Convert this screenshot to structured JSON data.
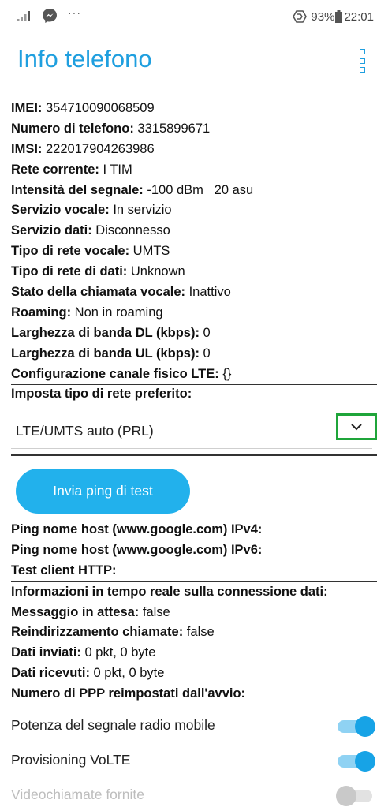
{
  "status_bar": {
    "more": "···",
    "battery": "93%",
    "time": "22:01"
  },
  "header": {
    "title": "Info telefono"
  },
  "info": [
    {
      "key": "IMEI:",
      "value": " 354710090068509"
    },
    {
      "key": "Numero di telefono:",
      "value": " 3315899671"
    },
    {
      "key": "IMSI:",
      "value": " 222017904263986"
    },
    {
      "key": "Rete corrente:",
      "value": " I TIM"
    },
    {
      "key": "Intensità del segnale:",
      "value": " -100 dBm   20 asu"
    },
    {
      "key": "Servizio vocale:",
      "value": " In servizio"
    },
    {
      "key": "Servizio dati:",
      "value": " Disconnesso"
    },
    {
      "key": "Tipo di rete vocale:",
      "value": " UMTS"
    },
    {
      "key": "Tipo di rete di dati:",
      "value": " Unknown"
    },
    {
      "key": "Stato della chiamata vocale:",
      "value": " Inattivo"
    },
    {
      "key": "Roaming:",
      "value": " Non in roaming"
    },
    {
      "key": "Larghezza di banda DL (kbps):",
      "value": " 0"
    },
    {
      "key": "Larghezza di banda UL (kbps):",
      "value": " 0"
    },
    {
      "key": "Configurazione canale fisico LTE:",
      "value": " {}"
    }
  ],
  "preferred_network": {
    "label": "Imposta tipo di rete preferito:",
    "selected": "LTE/UMTS auto (PRL)"
  },
  "ping_button_label": "Invia ping di test",
  "ping": [
    {
      "key": "Ping nome host (www.google.com) IPv4:",
      "value": ""
    },
    {
      "key": "Ping nome host (www.google.com) IPv6:",
      "value": ""
    },
    {
      "key": "Test client HTTP:",
      "value": ""
    },
    {
      "key": "Informazioni in tempo reale sulla connessione dati:",
      "value": ""
    },
    {
      "key": "Messaggio in attesa:",
      "value": " false"
    },
    {
      "key": "Reindirizzamento chiamate:",
      "value": " false"
    },
    {
      "key": "Dati inviati:",
      "value": " 0 pkt, 0 byte"
    },
    {
      "key": "Dati ricevuti:",
      "value": " 0 pkt, 0 byte"
    },
    {
      "key": "Numero di PPP reimpostati dall'avvio:",
      "value": ""
    }
  ],
  "toggles": [
    {
      "label": "Potenza del segnale radio mobile",
      "on": true
    },
    {
      "label": "Provisioning VoLTE",
      "on": true
    },
    {
      "label": "Videochiamate fornite",
      "on": false
    }
  ],
  "colors": {
    "accent": "#1f9fdf",
    "button": "#22b1ec",
    "highlight_box": "#1fa53a"
  }
}
